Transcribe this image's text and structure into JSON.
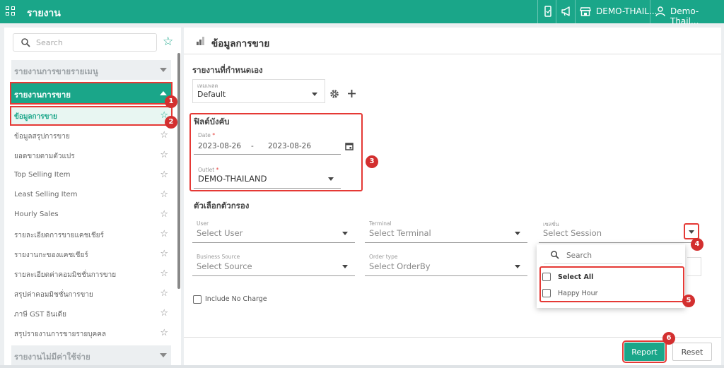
{
  "topbar": {
    "title": "รายงาน",
    "outlet": "DEMO-THAIL...",
    "user": "Demo- Thail..."
  },
  "sidebar": {
    "search_placeholder": "Search",
    "groups": [
      {
        "label": "รายงานการขายรายเมนู"
      },
      {
        "label": "รายงานการขาย"
      },
      {
        "label": "รายงานไม่มีค่าใช้จ่าย"
      }
    ],
    "items": [
      {
        "label": "ข้อมูลการขาย"
      },
      {
        "label": "ข้อมูลสรุปการขาย"
      },
      {
        "label": "ยอดขายตามตัวแปร"
      },
      {
        "label": "Top Selling Item"
      },
      {
        "label": "Least Selling Item"
      },
      {
        "label": "Hourly Sales"
      },
      {
        "label": "รายละเอียดการขายแคชเชียร์"
      },
      {
        "label": "รายงานกะของแคชเชียร์"
      },
      {
        "label": "รายละเอียดค่าคอมมิชชั่นการขาย"
      },
      {
        "label": "สรุปค่าคอมมิชชั่นการขาย"
      },
      {
        "label": "ภาษี GST อินเดีย"
      },
      {
        "label": "สรุปรายงานการขายรายบุคคล"
      }
    ]
  },
  "main": {
    "title": "ข้อมูลการขาย",
    "custom_report": {
      "heading": "รายงานที่กำหนดเอง",
      "template_label": "เทมเพลต",
      "template_value": "Default"
    },
    "required": {
      "heading": "ฟิลด์บังคับ",
      "date_label": "Date",
      "date_from": "2023-08-26",
      "date_sep": "-",
      "date_to": "2023-08-26",
      "outlet_label": "Outlet",
      "outlet_value": "DEMO-THAILAND"
    },
    "filters": {
      "heading": "ตัวเลือกตัวกรอง",
      "user_label": "User",
      "user_placeholder": "Select User",
      "terminal_label": "Terminal",
      "terminal_placeholder": "Select Terminal",
      "session_label": "เซสชั่น",
      "session_placeholder": "Select Session",
      "business_source_label": "Business Source",
      "business_source_placeholder": "Select Source",
      "order_type_label": "Order type",
      "order_type_placeholder": "Select OrderBy",
      "include_no_charge": "Include No Charge"
    },
    "session_dropdown": {
      "search_placeholder": "Search",
      "options": [
        {
          "label": "Select All",
          "checked": false
        },
        {
          "label": "Happy Hour",
          "checked": false
        }
      ]
    },
    "footer": {
      "report": "Report",
      "reset": "Reset"
    }
  },
  "badges": [
    "1",
    "2",
    "3",
    "4",
    "5",
    "6"
  ],
  "colors": {
    "brand": "#1aa689",
    "annotation": "#e53935"
  }
}
